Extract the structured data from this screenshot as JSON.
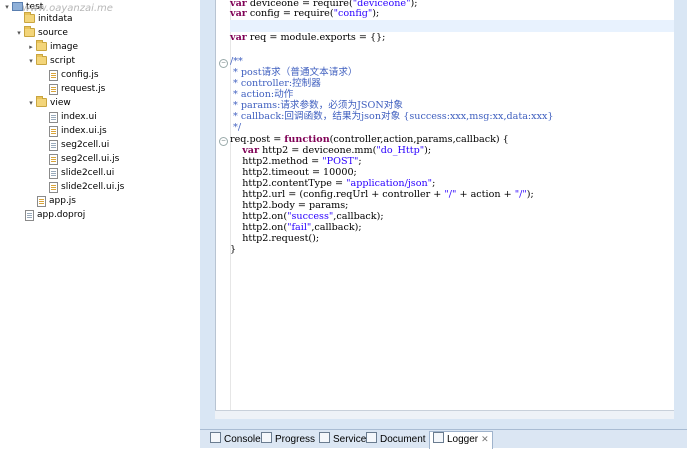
{
  "watermark": "www.oayanzai.me",
  "tree": [
    {
      "label": "test",
      "type": "project",
      "twisty": "▾"
    },
    {
      "label": "initdata",
      "type": "folder",
      "twisty": ""
    },
    {
      "label": "source",
      "type": "folder",
      "twisty": "▾"
    },
    {
      "label": "image",
      "type": "folder",
      "twisty": "▸"
    },
    {
      "label": "script",
      "type": "folder",
      "twisty": "▾"
    },
    {
      "label": "config.js",
      "type": "js",
      "twisty": ""
    },
    {
      "label": "request.js",
      "type": "js",
      "twisty": ""
    },
    {
      "label": "view",
      "type": "folder",
      "twisty": "▾"
    },
    {
      "label": "index.ui",
      "type": "file",
      "twisty": ""
    },
    {
      "label": "index.ui.js",
      "type": "js",
      "twisty": ""
    },
    {
      "label": "seg2cell.ui",
      "type": "file",
      "twisty": ""
    },
    {
      "label": "seg2cell.ui.js",
      "type": "js",
      "twisty": ""
    },
    {
      "label": "slide2cell.ui",
      "type": "file",
      "twisty": ""
    },
    {
      "label": "slide2cell.ui.js",
      "type": "js",
      "twisty": ""
    },
    {
      "label": "app.js",
      "type": "js",
      "twisty": ""
    },
    {
      "label": "app.doproj",
      "type": "file",
      "twisty": ""
    }
  ],
  "code": {
    "lines": [
      {
        "segs": [
          {
            "t": "var",
            "c": "kw"
          },
          {
            "t": " deviceone = require(",
            "c": ""
          },
          {
            "t": "\"deviceone\"",
            "c": "str"
          },
          {
            "t": ");",
            "c": ""
          }
        ]
      },
      {
        "segs": [
          {
            "t": "var",
            "c": "kw"
          },
          {
            "t": " config = require(",
            "c": ""
          },
          {
            "t": "\"config\"",
            "c": "str"
          },
          {
            "t": ");",
            "c": ""
          }
        ]
      },
      {
        "segs": [
          {
            "t": "",
            "c": ""
          }
        ],
        "highlight": true
      },
      {
        "segs": [
          {
            "t": "var",
            "c": "kw"
          },
          {
            "t": " req = module.exports = {};",
            "c": ""
          }
        ]
      },
      {
        "segs": [
          {
            "t": "",
            "c": ""
          }
        ]
      },
      {
        "segs": [
          {
            "t": "/**",
            "c": "cm"
          }
        ],
        "fold": true
      },
      {
        "segs": [
          {
            "t": " * post请求（普通文本请求）",
            "c": "cm"
          }
        ]
      },
      {
        "segs": [
          {
            "t": " * controller:控制器",
            "c": "cm"
          }
        ]
      },
      {
        "segs": [
          {
            "t": " * action:动作",
            "c": "cm"
          }
        ]
      },
      {
        "segs": [
          {
            "t": " * params:请求参数，必须为JSON对象",
            "c": "cm"
          }
        ]
      },
      {
        "segs": [
          {
            "t": " * callback:回调函数，结果为json对象 {success:xxx,msg:xx,data:xxx}",
            "c": "cm"
          }
        ]
      },
      {
        "segs": [
          {
            "t": " */",
            "c": "cm"
          }
        ]
      },
      {
        "segs": [
          {
            "t": "req.post = ",
            "c": ""
          },
          {
            "t": "function",
            "c": "kw"
          },
          {
            "t": "(controller,action,params,callback) {",
            "c": ""
          }
        ],
        "fold": true
      },
      {
        "segs": [
          {
            "t": "    ",
            "c": ""
          },
          {
            "t": "var",
            "c": "kw"
          },
          {
            "t": " http2 = deviceone.mm(",
            "c": ""
          },
          {
            "t": "\"do_Http\"",
            "c": "str"
          },
          {
            "t": ");",
            "c": ""
          }
        ]
      },
      {
        "segs": [
          {
            "t": "    http2.method = ",
            "c": ""
          },
          {
            "t": "\"POST\"",
            "c": "str"
          },
          {
            "t": ";",
            "c": ""
          }
        ]
      },
      {
        "segs": [
          {
            "t": "    http2.timeout = 10000;",
            "c": ""
          }
        ]
      },
      {
        "segs": [
          {
            "t": "    http2.contentType = ",
            "c": ""
          },
          {
            "t": "\"application/json\"",
            "c": "str"
          },
          {
            "t": ";",
            "c": ""
          }
        ]
      },
      {
        "segs": [
          {
            "t": "    http2.url = (config.reqUrl + controller + ",
            "c": ""
          },
          {
            "t": "\"/\"",
            "c": "str"
          },
          {
            "t": " + action + ",
            "c": ""
          },
          {
            "t": "\"/\"",
            "c": "str"
          },
          {
            "t": ");",
            "c": ""
          }
        ]
      },
      {
        "segs": [
          {
            "t": "    http2.body = params;",
            "c": ""
          }
        ]
      },
      {
        "segs": [
          {
            "t": "    http2.on(",
            "c": ""
          },
          {
            "t": "\"success\"",
            "c": "str"
          },
          {
            "t": ",callback);",
            "c": ""
          }
        ]
      },
      {
        "segs": [
          {
            "t": "    http2.on(",
            "c": ""
          },
          {
            "t": "\"fail\"",
            "c": "str"
          },
          {
            "t": ",callback);",
            "c": ""
          }
        ]
      },
      {
        "segs": [
          {
            "t": "    http2.request();",
            "c": ""
          }
        ]
      },
      {
        "segs": [
          {
            "t": "}",
            "c": ""
          }
        ]
      }
    ]
  },
  "bottom_tabs": [
    {
      "label": "Console",
      "active": false
    },
    {
      "label": "Progress",
      "active": false
    },
    {
      "label": "Service",
      "active": false
    },
    {
      "label": "Document",
      "active": false
    },
    {
      "label": "Logger",
      "active": true,
      "close": "✕"
    }
  ]
}
